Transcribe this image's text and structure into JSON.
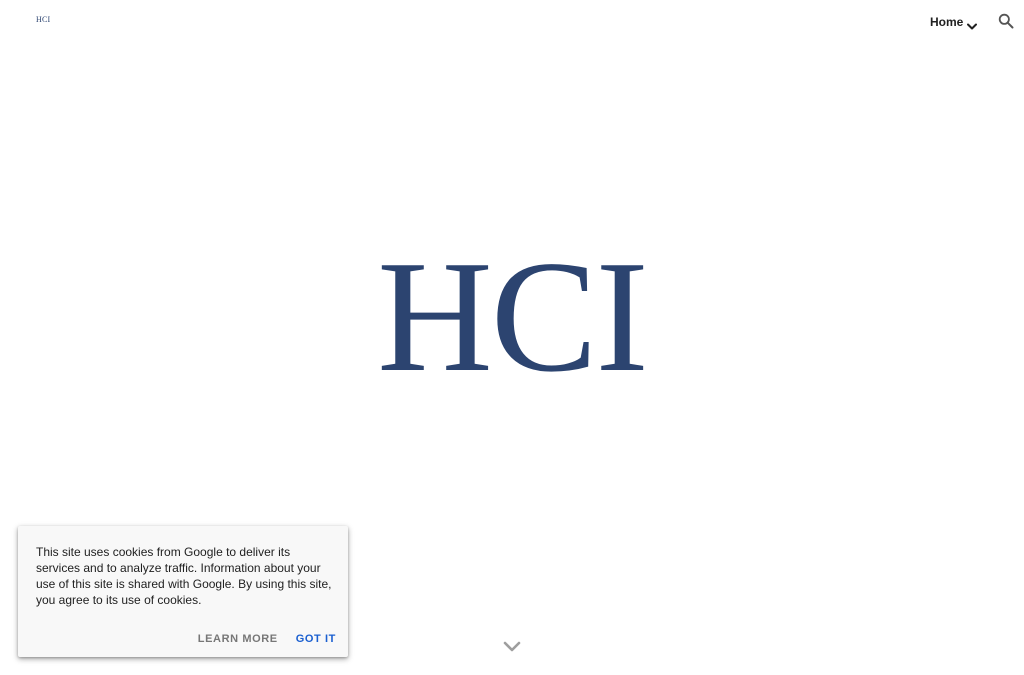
{
  "header": {
    "logo_text": "HCI",
    "nav_home_label": "Home"
  },
  "hero": {
    "title": "HCI"
  },
  "cookie_banner": {
    "message": "This site uses cookies from Google to deliver its services and to analyze traffic. Information about your use of this site is shared with Google. By using this site, you agree to its use of cookies.",
    "learn_more_label": "LEARN MORE",
    "got_it_label": "GOT IT"
  },
  "icons": {
    "nav_dropdown": "chevron-down-icon",
    "search": "search-icon",
    "scroll_down": "chevron-down-icon"
  },
  "colors": {
    "brand_navy": "#2c4470",
    "accent_blue": "#1a5fd0",
    "text_dark": "#212121",
    "text_muted": "#777777"
  }
}
